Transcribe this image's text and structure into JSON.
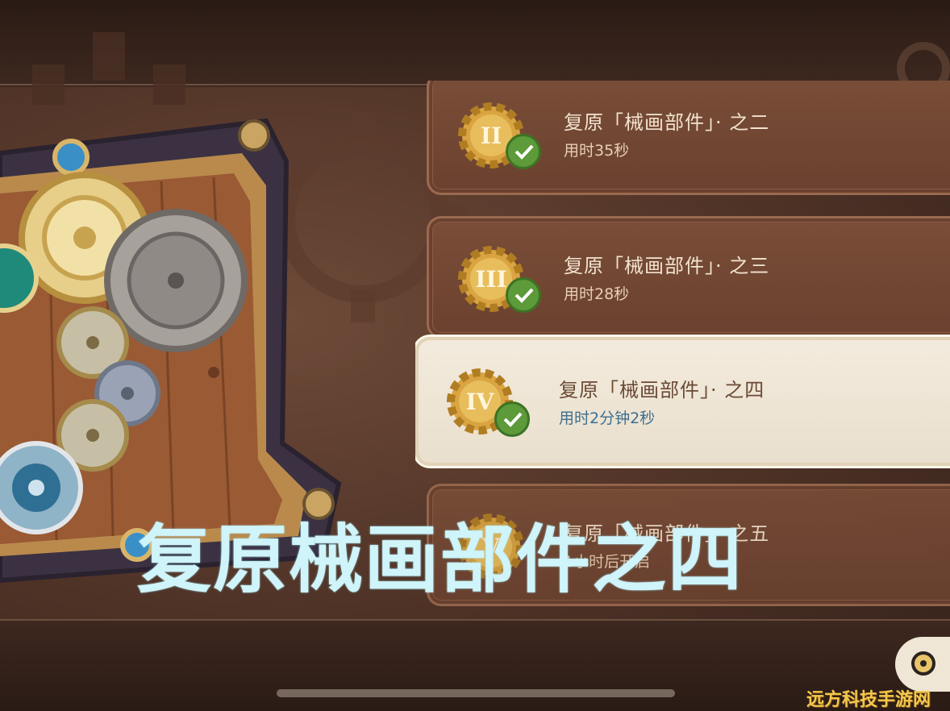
{
  "puzzle": {
    "name": "gear-puzzle-board"
  },
  "levels": [
    {
      "numeral": "II",
      "title": "复原「械画部件」· 之二",
      "time": "用时35秒",
      "completed": true,
      "selected": false
    },
    {
      "numeral": "III",
      "title": "复原「械画部件」· 之三",
      "time": "用时28秒",
      "completed": true,
      "selected": false
    },
    {
      "numeral": "IV",
      "title": "复原「械画部件」· 之四",
      "time": "用时2分钟2秒",
      "completed": true,
      "selected": true
    },
    {
      "numeral": "V",
      "title": "复原「械画部件」· 之五",
      "time": "1小时后开启",
      "completed": false,
      "selected": false
    }
  ],
  "overlay": {
    "title": "复原械画部件之四"
  },
  "watermark": "远方科技手游网",
  "colors": {
    "card_bg": "#6a412f",
    "card_selected_bg": "#f3ebdd",
    "gold": "#d9a441",
    "check_green": "#5d9a3a",
    "overlay_text": "#cff4fa"
  },
  "icons": {
    "completed": "checkmark-icon",
    "level_badge": "gear-icon",
    "corner": "paimon-menu-icon"
  }
}
